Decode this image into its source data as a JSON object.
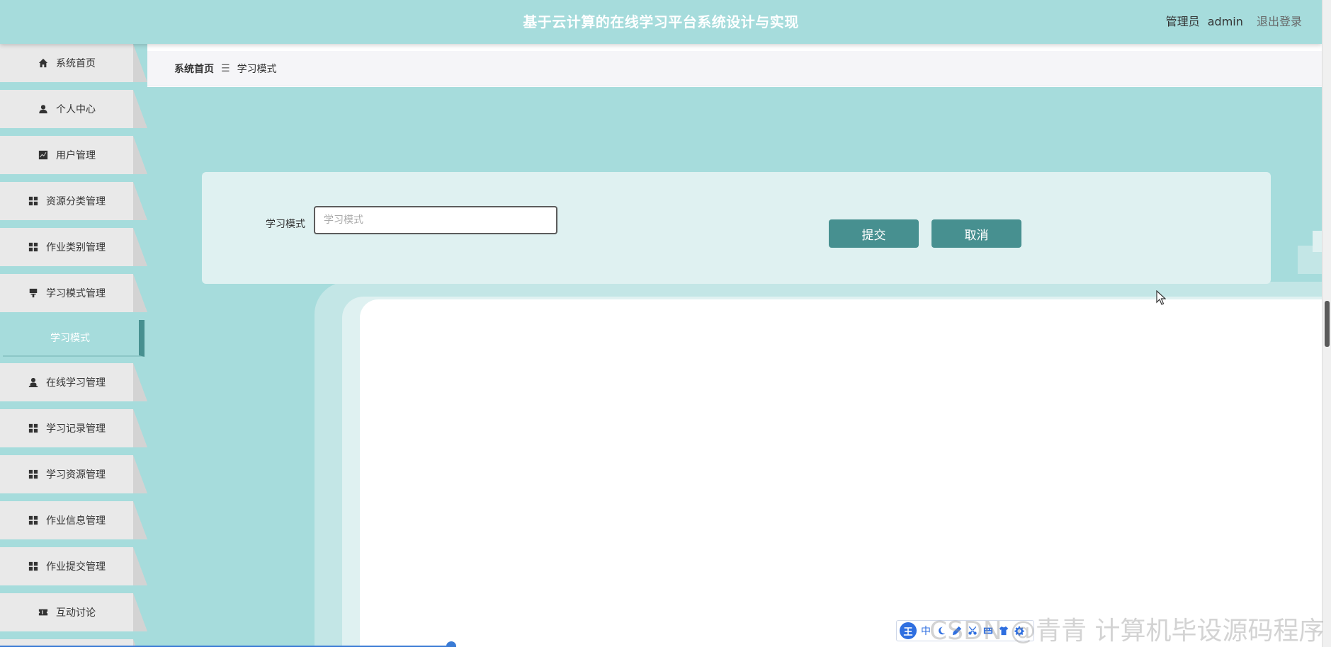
{
  "header": {
    "title": "基于云计算的在线学习平台系统设计与实现",
    "role": "管理员",
    "username": "admin",
    "logout": "退出登录"
  },
  "sidebar": {
    "items": [
      {
        "label": "系统首页",
        "icon": "home-icon"
      },
      {
        "label": "个人中心",
        "icon": "user-icon"
      },
      {
        "label": "用户管理",
        "icon": "chart-icon"
      },
      {
        "label": "资源分类管理",
        "icon": "grid-icon"
      },
      {
        "label": "作业类别管理",
        "icon": "grid-icon"
      },
      {
        "label": "学习模式管理",
        "icon": "brush-icon"
      },
      {
        "label": "学习模式",
        "active": true
      },
      {
        "label": "在线学习管理",
        "icon": "person-icon"
      },
      {
        "label": "学习记录管理",
        "icon": "grid-icon"
      },
      {
        "label": "学习资源管理",
        "icon": "grid-icon"
      },
      {
        "label": "作业信息管理",
        "icon": "grid-icon"
      },
      {
        "label": "作业提交管理",
        "icon": "grid-icon"
      },
      {
        "label": "互动讨论",
        "icon": "ticket-icon"
      }
    ]
  },
  "breadcrumb": {
    "home": "系统首页",
    "separator": "☰",
    "current": "学习模式"
  },
  "form": {
    "field_label": "学习模式",
    "field_placeholder": "学习模式",
    "submit_label": "提交",
    "cancel_label": "取消"
  },
  "ime_toolbar": {
    "logo": "王",
    "lang": "中"
  },
  "watermark": "CSDN @青青  计算机毕设源码程序",
  "colors": {
    "teal": "#a6dcdc",
    "button": "#479090",
    "menu_bg": "#e9e9e9"
  }
}
